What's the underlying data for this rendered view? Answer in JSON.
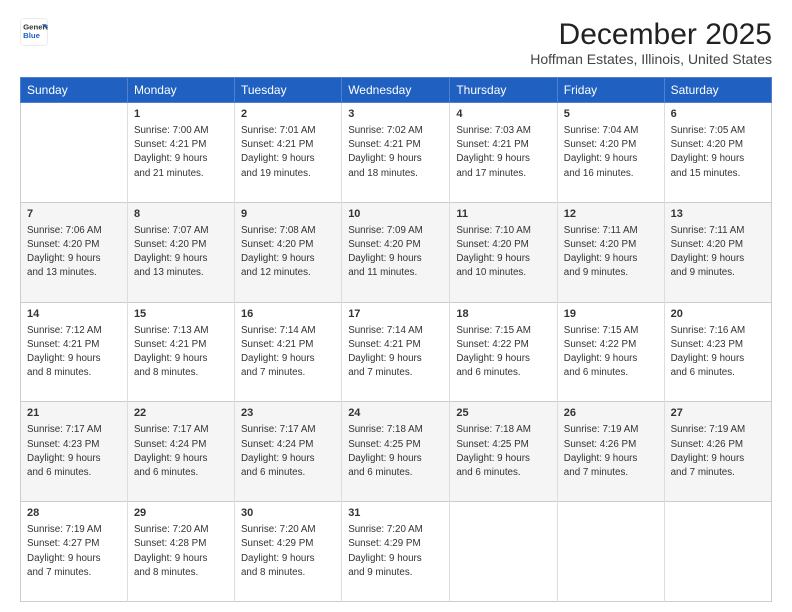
{
  "logo": {
    "line1": "General",
    "line2": "Blue"
  },
  "header": {
    "title": "December 2025",
    "subtitle": "Hoffman Estates, Illinois, United States"
  },
  "days_of_week": [
    "Sunday",
    "Monday",
    "Tuesday",
    "Wednesday",
    "Thursday",
    "Friday",
    "Saturday"
  ],
  "weeks": [
    [
      {
        "day": "",
        "info": ""
      },
      {
        "day": "1",
        "info": "Sunrise: 7:00 AM\nSunset: 4:21 PM\nDaylight: 9 hours\nand 21 minutes."
      },
      {
        "day": "2",
        "info": "Sunrise: 7:01 AM\nSunset: 4:21 PM\nDaylight: 9 hours\nand 19 minutes."
      },
      {
        "day": "3",
        "info": "Sunrise: 7:02 AM\nSunset: 4:21 PM\nDaylight: 9 hours\nand 18 minutes."
      },
      {
        "day": "4",
        "info": "Sunrise: 7:03 AM\nSunset: 4:21 PM\nDaylight: 9 hours\nand 17 minutes."
      },
      {
        "day": "5",
        "info": "Sunrise: 7:04 AM\nSunset: 4:20 PM\nDaylight: 9 hours\nand 16 minutes."
      },
      {
        "day": "6",
        "info": "Sunrise: 7:05 AM\nSunset: 4:20 PM\nDaylight: 9 hours\nand 15 minutes."
      }
    ],
    [
      {
        "day": "7",
        "info": "Sunrise: 7:06 AM\nSunset: 4:20 PM\nDaylight: 9 hours\nand 13 minutes."
      },
      {
        "day": "8",
        "info": "Sunrise: 7:07 AM\nSunset: 4:20 PM\nDaylight: 9 hours\nand 13 minutes."
      },
      {
        "day": "9",
        "info": "Sunrise: 7:08 AM\nSunset: 4:20 PM\nDaylight: 9 hours\nand 12 minutes."
      },
      {
        "day": "10",
        "info": "Sunrise: 7:09 AM\nSunset: 4:20 PM\nDaylight: 9 hours\nand 11 minutes."
      },
      {
        "day": "11",
        "info": "Sunrise: 7:10 AM\nSunset: 4:20 PM\nDaylight: 9 hours\nand 10 minutes."
      },
      {
        "day": "12",
        "info": "Sunrise: 7:11 AM\nSunset: 4:20 PM\nDaylight: 9 hours\nand 9 minutes."
      },
      {
        "day": "13",
        "info": "Sunrise: 7:11 AM\nSunset: 4:20 PM\nDaylight: 9 hours\nand 9 minutes."
      }
    ],
    [
      {
        "day": "14",
        "info": "Sunrise: 7:12 AM\nSunset: 4:21 PM\nDaylight: 9 hours\nand 8 minutes."
      },
      {
        "day": "15",
        "info": "Sunrise: 7:13 AM\nSunset: 4:21 PM\nDaylight: 9 hours\nand 8 minutes."
      },
      {
        "day": "16",
        "info": "Sunrise: 7:14 AM\nSunset: 4:21 PM\nDaylight: 9 hours\nand 7 minutes."
      },
      {
        "day": "17",
        "info": "Sunrise: 7:14 AM\nSunset: 4:21 PM\nDaylight: 9 hours\nand 7 minutes."
      },
      {
        "day": "18",
        "info": "Sunrise: 7:15 AM\nSunset: 4:22 PM\nDaylight: 9 hours\nand 6 minutes."
      },
      {
        "day": "19",
        "info": "Sunrise: 7:15 AM\nSunset: 4:22 PM\nDaylight: 9 hours\nand 6 minutes."
      },
      {
        "day": "20",
        "info": "Sunrise: 7:16 AM\nSunset: 4:23 PM\nDaylight: 9 hours\nand 6 minutes."
      }
    ],
    [
      {
        "day": "21",
        "info": "Sunrise: 7:17 AM\nSunset: 4:23 PM\nDaylight: 9 hours\nand 6 minutes."
      },
      {
        "day": "22",
        "info": "Sunrise: 7:17 AM\nSunset: 4:24 PM\nDaylight: 9 hours\nand 6 minutes."
      },
      {
        "day": "23",
        "info": "Sunrise: 7:17 AM\nSunset: 4:24 PM\nDaylight: 9 hours\nand 6 minutes."
      },
      {
        "day": "24",
        "info": "Sunrise: 7:18 AM\nSunset: 4:25 PM\nDaylight: 9 hours\nand 6 minutes."
      },
      {
        "day": "25",
        "info": "Sunrise: 7:18 AM\nSunset: 4:25 PM\nDaylight: 9 hours\nand 6 minutes."
      },
      {
        "day": "26",
        "info": "Sunrise: 7:19 AM\nSunset: 4:26 PM\nDaylight: 9 hours\nand 7 minutes."
      },
      {
        "day": "27",
        "info": "Sunrise: 7:19 AM\nSunset: 4:26 PM\nDaylight: 9 hours\nand 7 minutes."
      }
    ],
    [
      {
        "day": "28",
        "info": "Sunrise: 7:19 AM\nSunset: 4:27 PM\nDaylight: 9 hours\nand 7 minutes."
      },
      {
        "day": "29",
        "info": "Sunrise: 7:20 AM\nSunset: 4:28 PM\nDaylight: 9 hours\nand 8 minutes."
      },
      {
        "day": "30",
        "info": "Sunrise: 7:20 AM\nSunset: 4:29 PM\nDaylight: 9 hours\nand 8 minutes."
      },
      {
        "day": "31",
        "info": "Sunrise: 7:20 AM\nSunset: 4:29 PM\nDaylight: 9 hours\nand 9 minutes."
      },
      {
        "day": "",
        "info": ""
      },
      {
        "day": "",
        "info": ""
      },
      {
        "day": "",
        "info": ""
      }
    ]
  ]
}
